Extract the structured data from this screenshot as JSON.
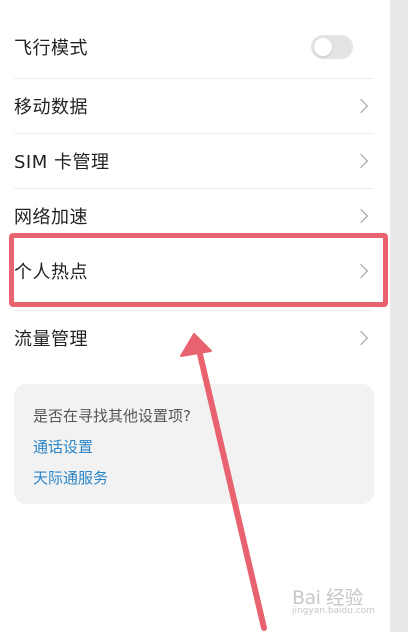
{
  "settings": {
    "items": [
      {
        "label": "飞行模式",
        "control": "toggle",
        "toggle_on": false
      },
      {
        "label": "移动数据",
        "control": "chevron"
      },
      {
        "label": "SIM 卡管理",
        "control": "chevron"
      },
      {
        "label": "网络加速",
        "control": "chevron"
      },
      {
        "label": "个人热点",
        "control": "chevron",
        "highlighted": true
      },
      {
        "label": "流量管理",
        "control": "chevron"
      }
    ]
  },
  "suggestion_card": {
    "title": "是否在寻找其他设置项?",
    "links": [
      "通话设置",
      "天际通服务"
    ]
  },
  "annotation": {
    "highlight_color": "#e8636f",
    "arrow_color": "#e8636f"
  },
  "watermark": {
    "logo_text": "Bai 经验",
    "url_text": "jingyan.baidu.com"
  },
  "colors": {
    "link": "#2c86c8",
    "text": "#222222",
    "toggle_off": "#e4e4e4",
    "card_bg": "#f2f2f2"
  }
}
